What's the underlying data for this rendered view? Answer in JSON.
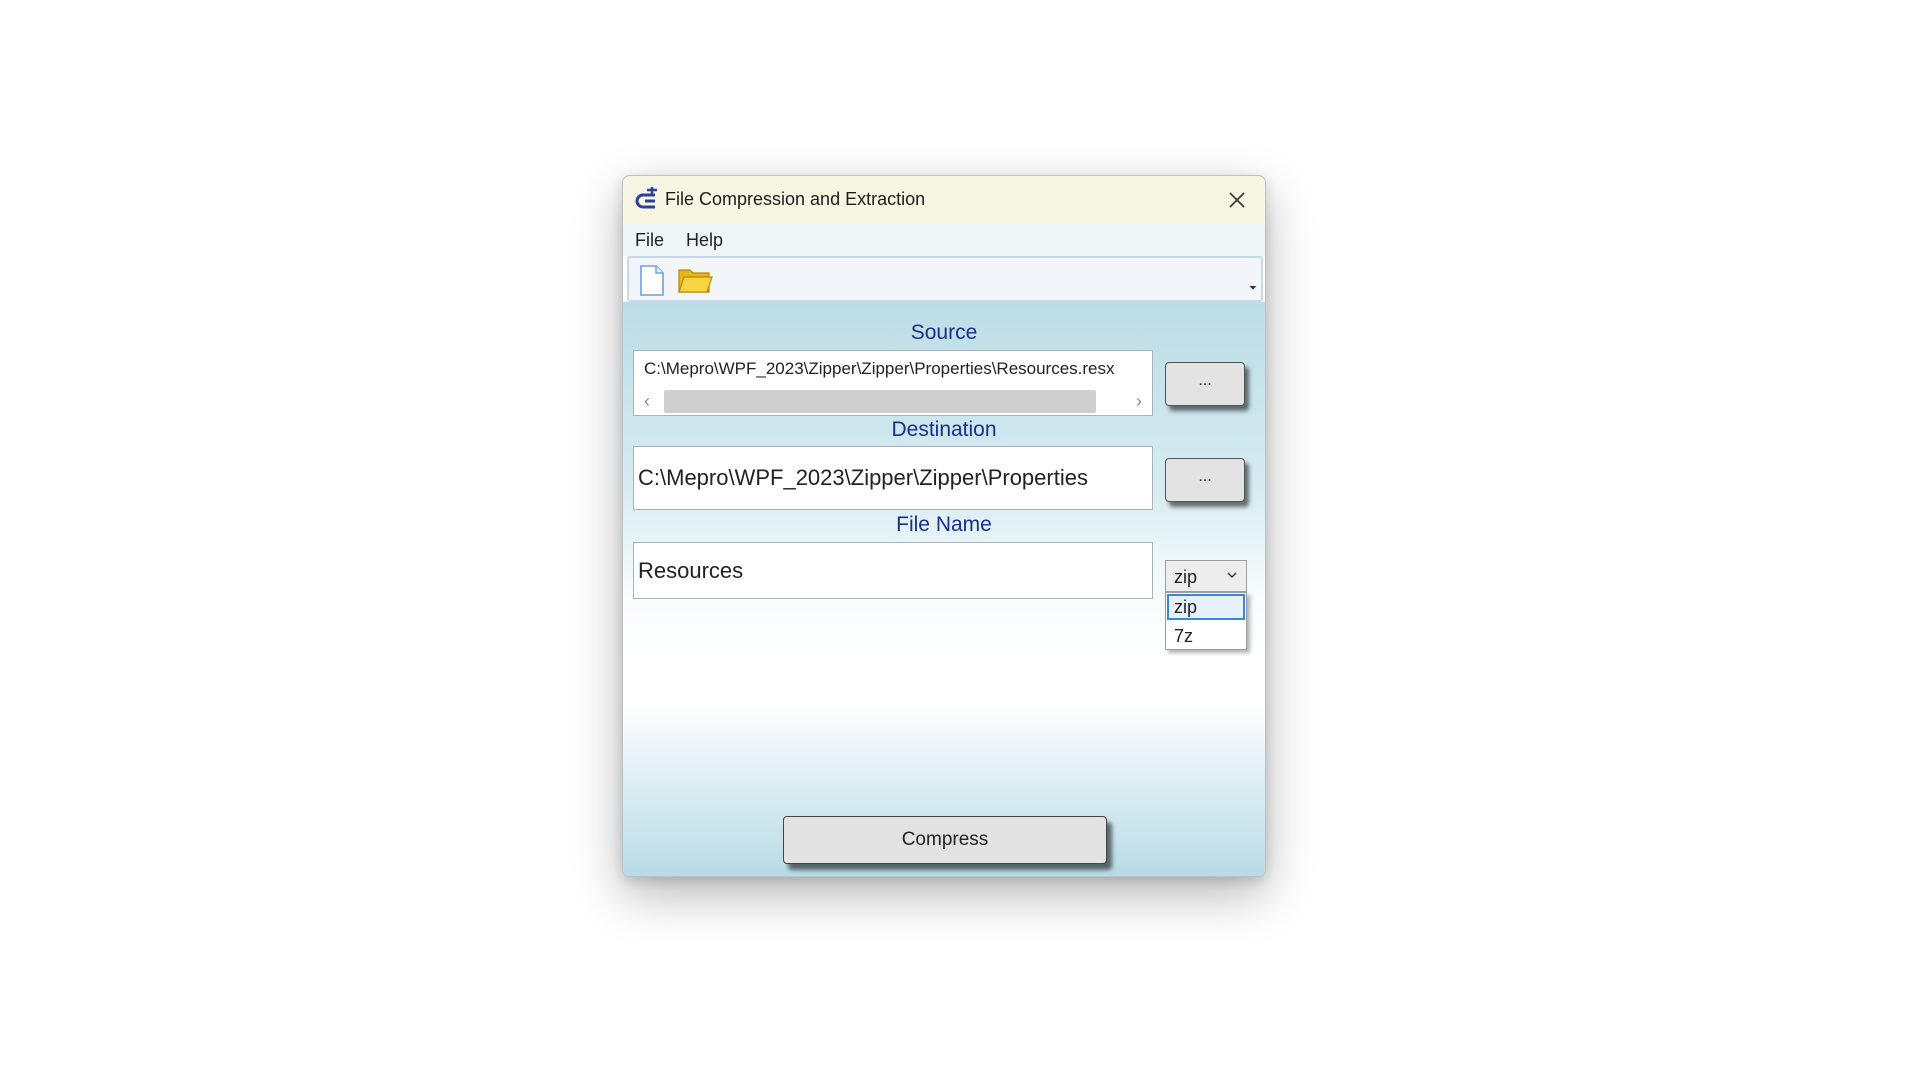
{
  "window": {
    "title": "File Compression and Extraction",
    "close_label": "✕"
  },
  "menu": {
    "items": [
      {
        "label": "File"
      },
      {
        "label": "Help"
      }
    ]
  },
  "toolbar": {
    "buttons": [
      {
        "icon": "new-file-icon"
      },
      {
        "icon": "open-folder-icon"
      }
    ],
    "overflow_label": "⏷"
  },
  "source": {
    "label": "Source",
    "value": "C:\\Mepro\\WPF_2023\\Zipper\\Zipper\\Properties\\Resources.resx",
    "browse_label": "..."
  },
  "destination": {
    "label": "Destination",
    "value": "C:\\Mepro\\WPF_2023\\Zipper\\Zipper\\Properties",
    "browse_label": "..."
  },
  "file_name": {
    "label": "File Name",
    "value": "Resources",
    "format": {
      "selected": "zip",
      "options": [
        "zip",
        "7z"
      ]
    }
  },
  "actions": {
    "compress_label": "Compress"
  },
  "colors": {
    "label_blue": "#1a2f8a",
    "title_bar": "#f7f6e2",
    "selection_border": "#3d86d6"
  }
}
